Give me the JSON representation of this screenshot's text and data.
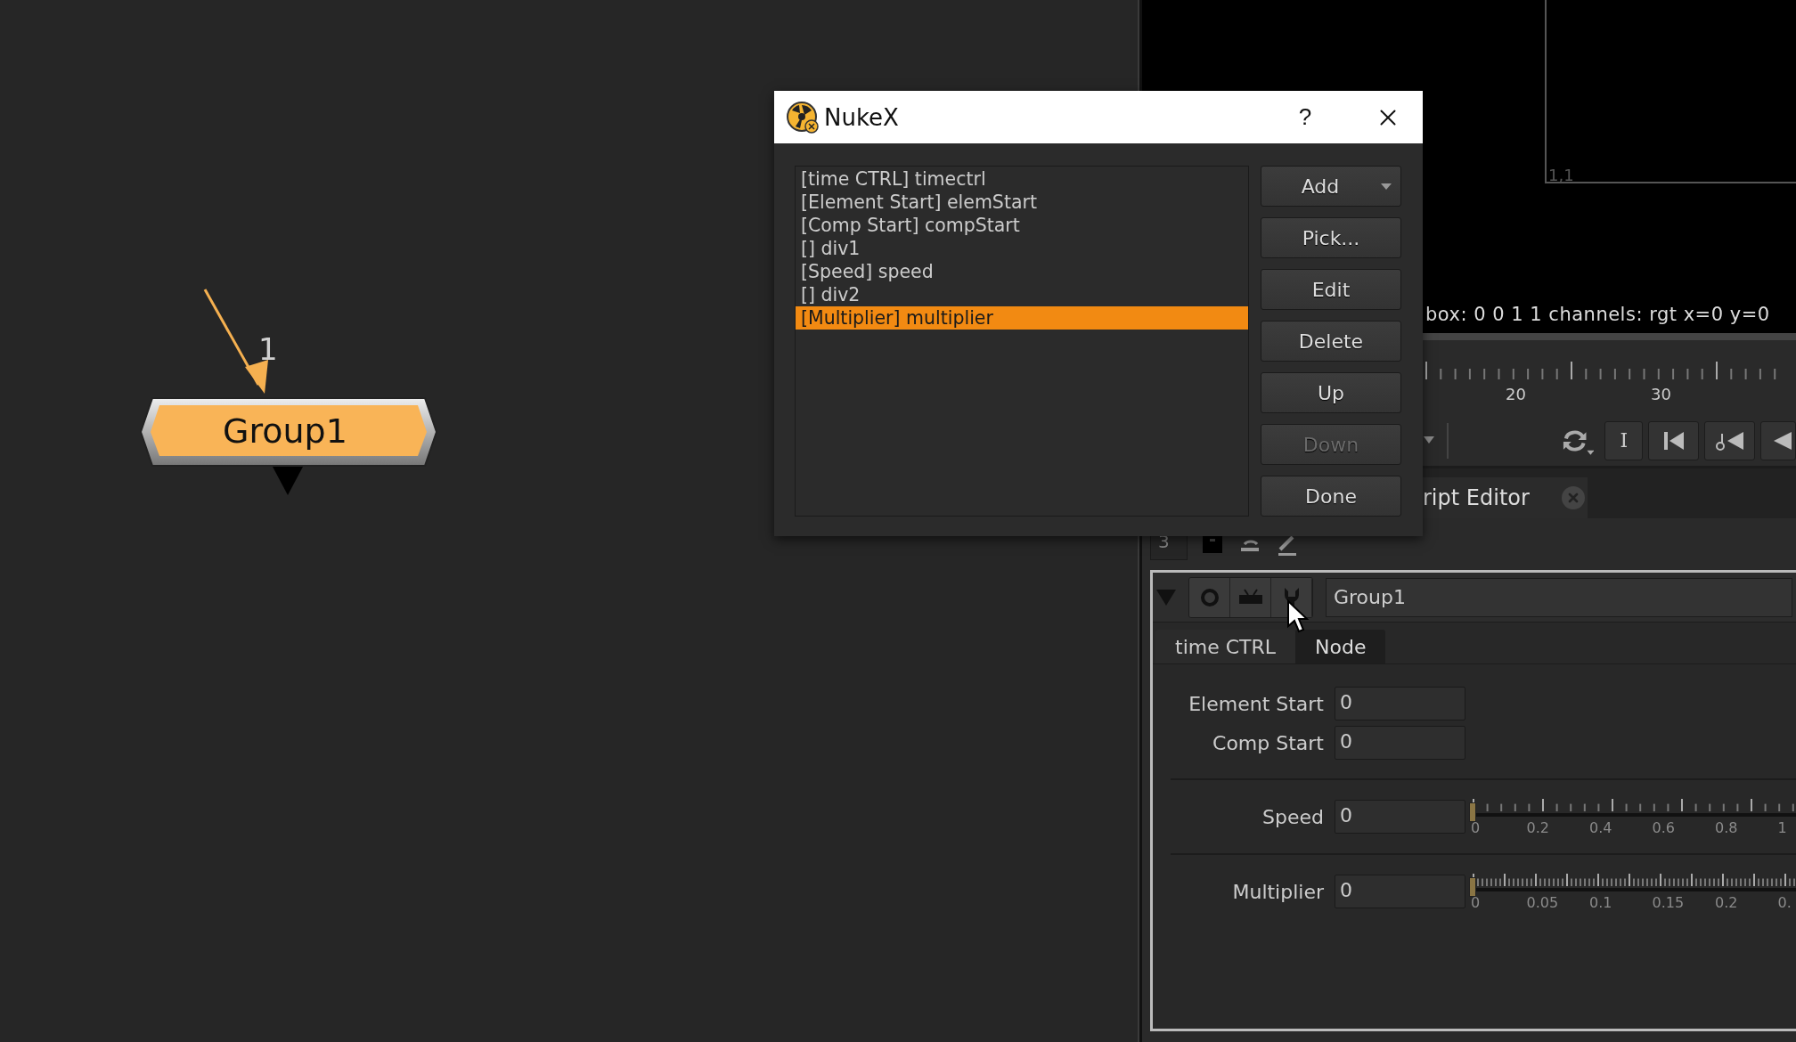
{
  "node_graph": {
    "node": {
      "label": "Group1"
    },
    "input_label": "1"
  },
  "viewer": {
    "frame_label": "1,1",
    "info": "box: 0 0 1 1 channels: rgt  x=0 y=0"
  },
  "timeline": {
    "labels": [
      "20",
      "30"
    ]
  },
  "transport": {
    "frame_button": "I"
  },
  "script_tab": {
    "label": "ript Editor"
  },
  "toolbar": {
    "field": "3"
  },
  "properties": {
    "name": "Group1",
    "tabs": [
      {
        "label": "time CTRL",
        "selected": true
      },
      {
        "label": "Node",
        "selected": false
      }
    ],
    "knobs": [
      {
        "kind": "number",
        "label": "Element Start",
        "value": "0"
      },
      {
        "kind": "number",
        "label": "Comp Start",
        "value": "0"
      },
      {
        "kind": "divider"
      },
      {
        "kind": "slider",
        "label": "Speed",
        "value": "0",
        "level": 0,
        "ticks": [
          "0",
          "0.2",
          "0.4",
          "0.6",
          "0.8",
          "1"
        ]
      },
      {
        "kind": "divider"
      },
      {
        "kind": "slider",
        "label": "Multiplier",
        "value": "0",
        "level": 0,
        "ticks": [
          "0",
          "0.05",
          "0.1",
          "0.15",
          "0.2",
          "0."
        ]
      }
    ]
  },
  "dialog": {
    "title": "NukeX",
    "help": "?",
    "items": [
      {
        "label": "[time CTRL] timectrl",
        "selected": false
      },
      {
        "label": "[Element Start] elemStart",
        "selected": false
      },
      {
        "label": "[Comp Start] compStart",
        "selected": false
      },
      {
        "label": "[] div1",
        "selected": false
      },
      {
        "label": "[Speed] speed",
        "selected": false
      },
      {
        "label": "[] div2",
        "selected": false
      },
      {
        "label": "[Multiplier] multiplier",
        "selected": true
      }
    ],
    "buttons": [
      {
        "label": "Add",
        "kind": "menu",
        "disabled": false
      },
      {
        "label": "Pick...",
        "kind": "plain",
        "disabled": false
      },
      {
        "label": "Edit",
        "kind": "plain",
        "disabled": false
      },
      {
        "label": "Delete",
        "kind": "plain",
        "disabled": false
      },
      {
        "label": "Up",
        "kind": "plain",
        "disabled": false
      },
      {
        "label": "Down",
        "kind": "plain",
        "disabled": true
      },
      {
        "label": "Done",
        "kind": "plain",
        "disabled": false
      }
    ]
  }
}
